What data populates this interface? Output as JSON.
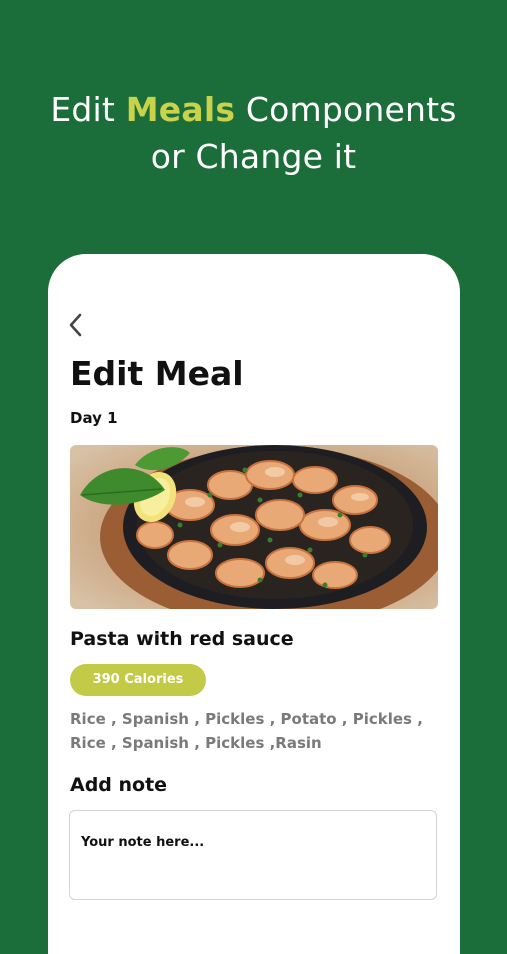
{
  "headline": {
    "line1_prefix": "Edit ",
    "line1_accent": "Meals",
    "line1_suffix": " Components",
    "line2": "or Change it"
  },
  "screen": {
    "title": "Edit Meal",
    "day": "Day 1",
    "meal_name": "Pasta with red sauce",
    "calories": "390 Calories",
    "ingredients": "Rice , Spanish , Pickles , Potato , Pickles , Rice , Spanish , Pickles ,Rasin",
    "add_note_label": "Add note",
    "note_placeholder": "Your note here..."
  },
  "colors": {
    "background": "#1b6e3a",
    "accent": "#c8d24a",
    "calorie_badge": "#c2ca48"
  },
  "icons": {
    "back": "chevron-left-icon"
  }
}
